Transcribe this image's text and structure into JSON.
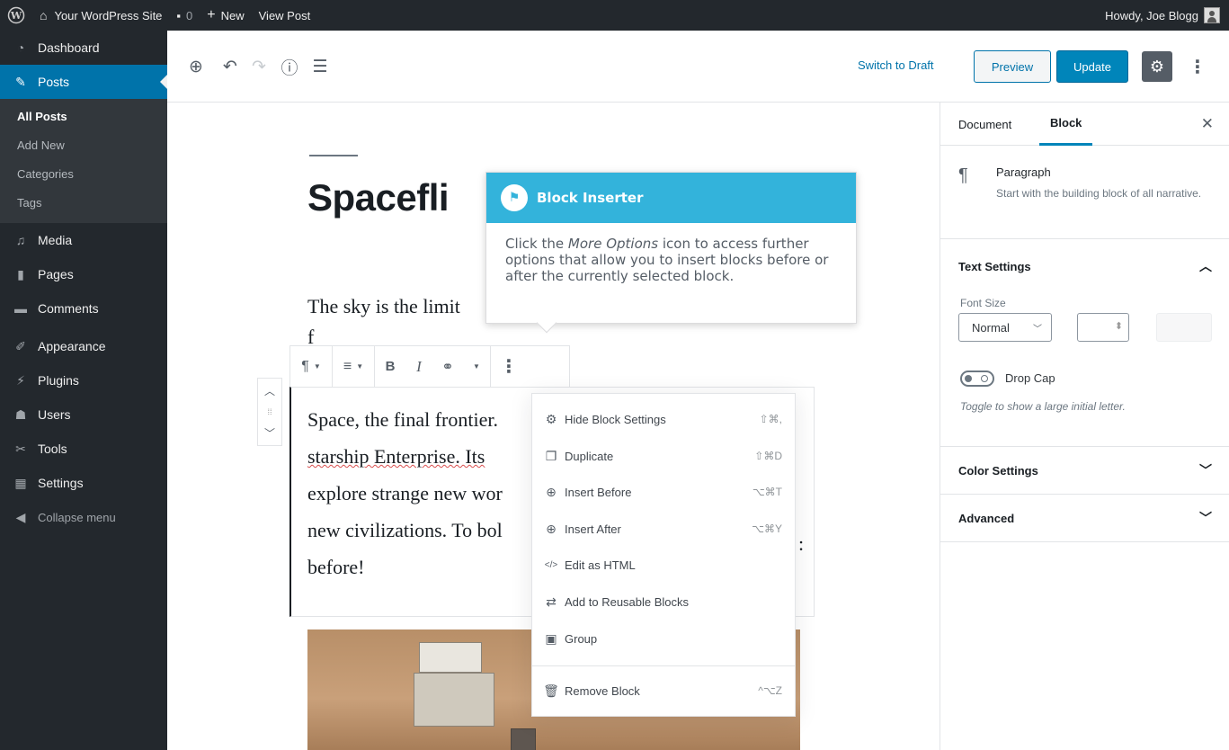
{
  "admin_bar": {
    "site_name": "Your WordPress Site",
    "comments_count": "0",
    "new_label": "New",
    "view_post_label": "View Post",
    "greeting": "Howdy, Joe Blogg"
  },
  "admin_menu": {
    "items": [
      {
        "label": "Dashboard",
        "icon": "dashboard-icon"
      },
      {
        "label": "Posts",
        "icon": "pin-icon"
      },
      {
        "label": "Media",
        "icon": "media-icon"
      },
      {
        "label": "Pages",
        "icon": "pages-icon"
      },
      {
        "label": "Comments",
        "icon": "comments-icon"
      },
      {
        "label": "Appearance",
        "icon": "brush-icon"
      },
      {
        "label": "Plugins",
        "icon": "plugin-icon"
      },
      {
        "label": "Users",
        "icon": "users-icon"
      },
      {
        "label": "Tools",
        "icon": "wrench-icon"
      },
      {
        "label": "Settings",
        "icon": "settings-icon"
      },
      {
        "label": "Collapse menu",
        "icon": "collapse-icon"
      }
    ],
    "posts_submenu": [
      "All Posts",
      "Add New",
      "Categories",
      "Tags"
    ]
  },
  "header": {
    "switch_to_draft": "Switch to Draft",
    "preview": "Preview",
    "update": "Update"
  },
  "post": {
    "title_visible": "Spacefli",
    "para1_visible": "The sky is the limit",
    "para1_cont_visible": "f",
    "para2_lines": [
      "Space, the final frontier.",
      "starship Enterprise. Its",
      "explore strange new wor",
      "new civilizations. To bol",
      "before!"
    ],
    "para2_tail": ":"
  },
  "guide": {
    "title": "Block Inserter",
    "body_pre": "Click the ",
    "body_em": "More Options",
    "body_post": " icon to access further options that allow you to insert blocks before or after the currently selected block."
  },
  "dropdown": {
    "items": [
      {
        "label": "Hide Block Settings",
        "shortcut": "⇧⌘,",
        "icon": "gear-icon"
      },
      {
        "label": "Duplicate",
        "shortcut": "⇧⌘D",
        "icon": "duplicate-icon"
      },
      {
        "label": "Insert Before",
        "shortcut": "⌥⌘T",
        "icon": "insert-before-icon"
      },
      {
        "label": "Insert After",
        "shortcut": "⌥⌘Y",
        "icon": "insert-after-icon"
      },
      {
        "label": "Edit as HTML",
        "shortcut": "",
        "icon": "html-icon"
      },
      {
        "label": "Add to Reusable Blocks",
        "shortcut": "",
        "icon": "reusable-icon"
      },
      {
        "label": "Group",
        "shortcut": "",
        "icon": "group-icon"
      }
    ],
    "remove": {
      "label": "Remove Block",
      "shortcut": "^⌥Z",
      "icon": "trash-icon"
    }
  },
  "sidebar": {
    "tab_document": "Document",
    "tab_block": "Block",
    "block_title": "Paragraph",
    "block_desc": "Start with the building block of all narrative.",
    "text_settings": "Text Settings",
    "font_size_label": "Font Size",
    "font_size_value": "Normal",
    "drop_cap_label": "Drop Cap",
    "drop_cap_help": "Toggle to show a large initial letter.",
    "color_settings": "Color Settings",
    "advanced": "Advanced"
  },
  "colors": {
    "admin_bg": "#23282d",
    "accent": "#0073aa",
    "guide_header": "#33b3db"
  }
}
